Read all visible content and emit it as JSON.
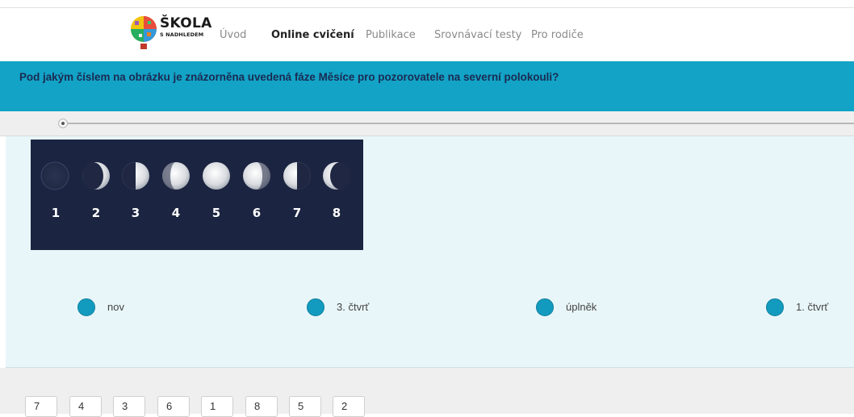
{
  "header": {
    "logo_main": "ŠKOLA",
    "logo_sub": "S NADHLEDEM",
    "nav": [
      "Úvod",
      "Online cvičení",
      "Publikace",
      "Srovnávací testy",
      "Pro rodiče"
    ],
    "active_nav": "Online cvičení"
  },
  "question": "Pod jakým číslem na obrázku je znázorněna uvedená fáze Měsíce pro pozorovatele na severní polokouli?",
  "moon_image": {
    "numbers": [
      "1",
      "2",
      "3",
      "4",
      "5",
      "6",
      "7",
      "8"
    ]
  },
  "options": [
    "nov",
    "3. čtvrť",
    "úplněk",
    "1. čtvrť"
  ],
  "answer_cards": [
    "7",
    "4",
    "3",
    "6",
    "1",
    "8",
    "5",
    "2"
  ],
  "colors": {
    "banner": "#12a3c6",
    "question_text": "#1b2a52",
    "radio": "#139bbf",
    "panel": "#e9f6f9",
    "image_bg": "#1b2440"
  }
}
